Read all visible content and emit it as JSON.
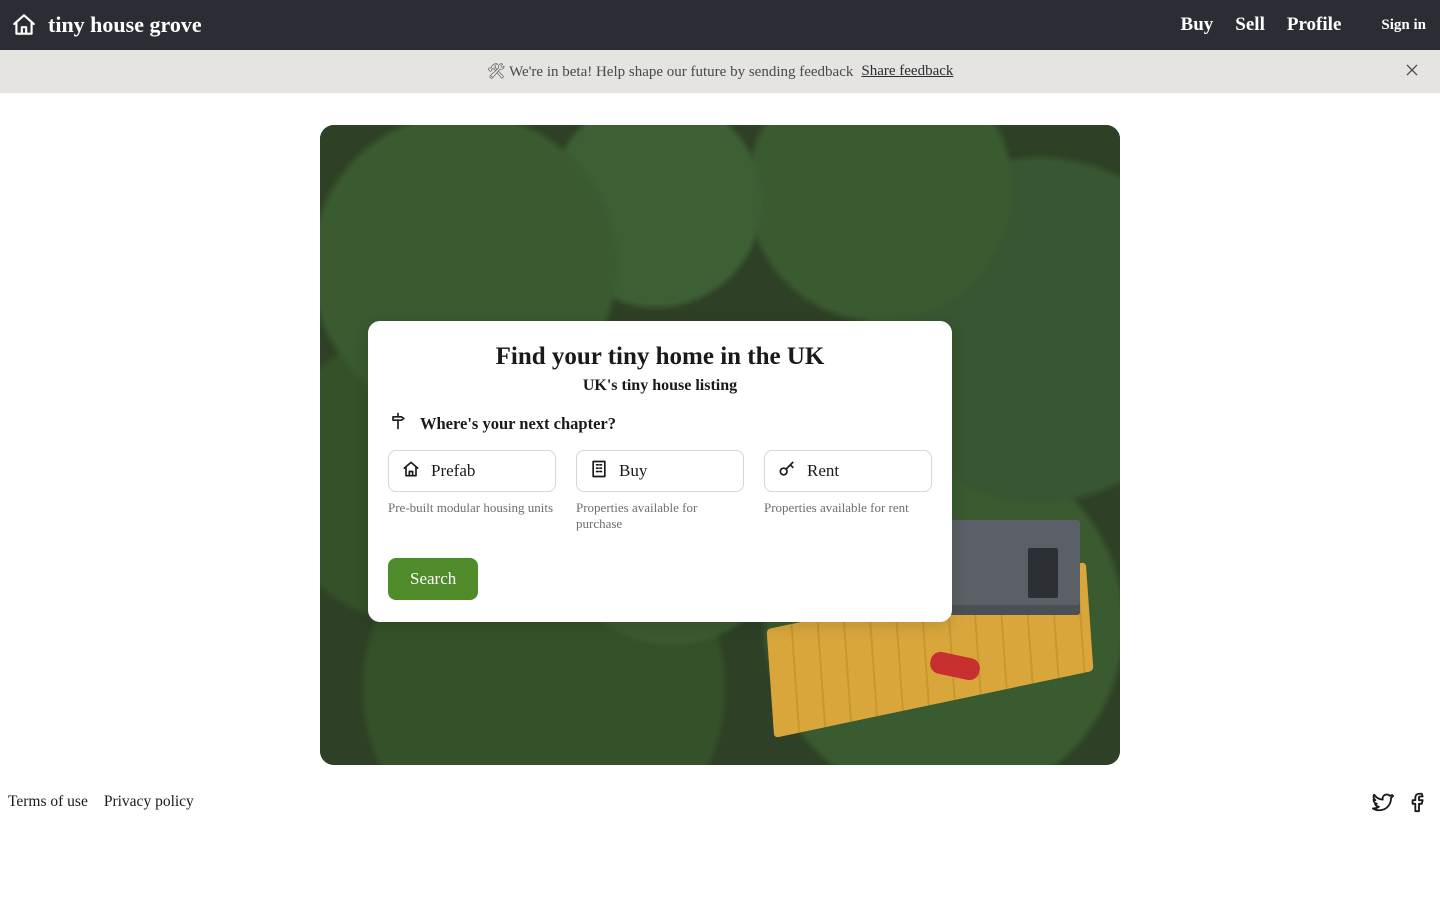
{
  "header": {
    "brand": "tiny house grove",
    "nav": {
      "buy": "Buy",
      "sell": "Sell",
      "profile": "Profile"
    },
    "sign_in": "Sign in"
  },
  "banner": {
    "text": "🛠 We're in beta! Help shape our future by sending feedback",
    "link": "Share feedback"
  },
  "hero": {
    "title": "Find your tiny home in the UK",
    "subtitle": "UK's tiny house listing",
    "prompt": "Where's your next chapter?",
    "options": [
      {
        "label": "Prefab",
        "desc": "Pre-built modular housing units"
      },
      {
        "label": "Buy",
        "desc": "Properties available for purchase"
      },
      {
        "label": "Rent",
        "desc": "Properties available for rent"
      }
    ],
    "search_button": "Search"
  },
  "footer": {
    "terms": "Terms of use",
    "privacy": "Privacy policy"
  }
}
